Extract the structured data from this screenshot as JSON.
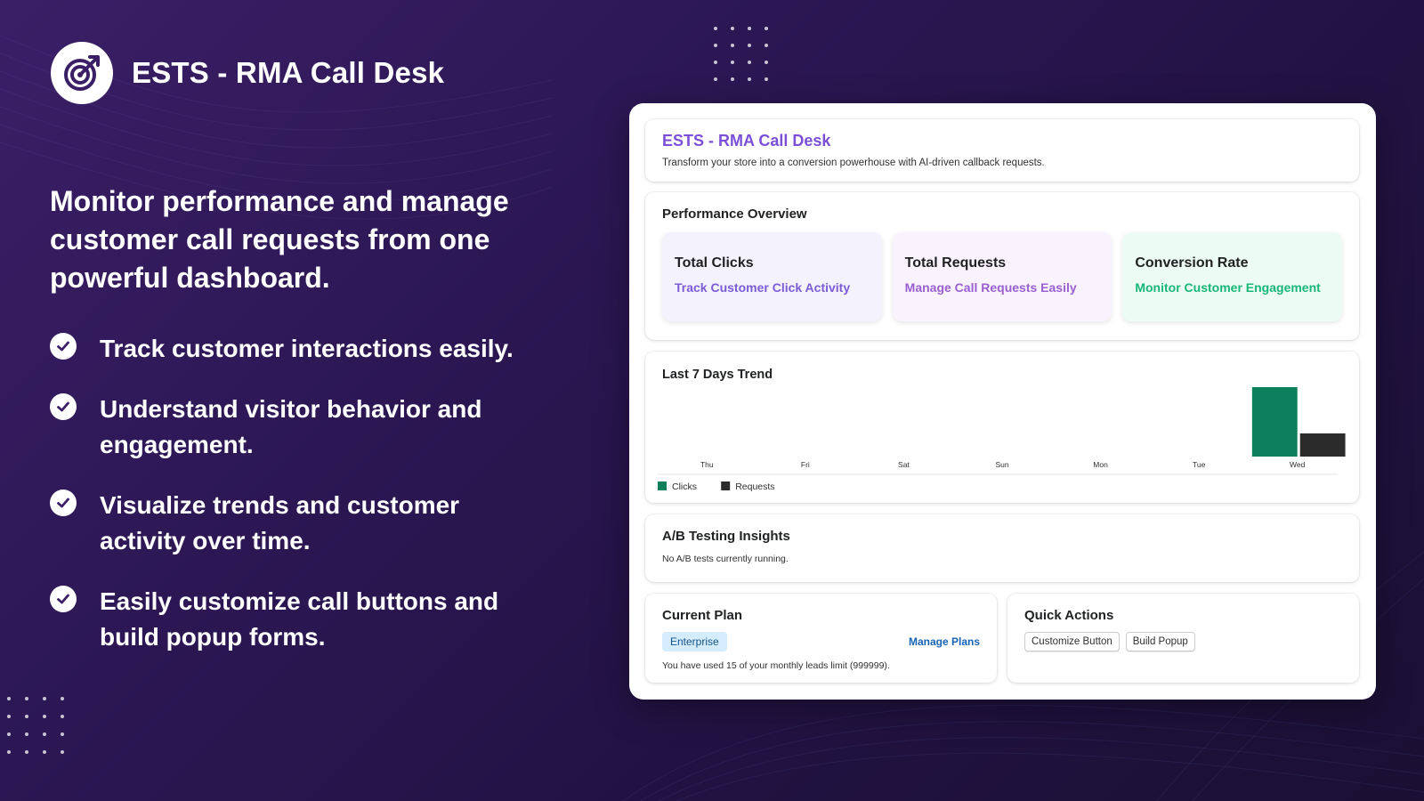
{
  "brand": {
    "title": "ESTS - RMA Call Desk",
    "logo_icon": "target-arrow-icon"
  },
  "headline": "Monitor performance and manage customer call requests from one powerful dashboard.",
  "features": [
    "Track customer interactions easily.",
    "Understand visitor behavior and engagement.",
    "Visualize trends and customer activity over time.",
    "Easily customize call buttons and build popup forms."
  ],
  "app": {
    "title": "ESTS - RMA Call Desk",
    "subtitle": "Transform your store into a conversion powerhouse with AI-driven callback requests."
  },
  "performance": {
    "title": "Performance Overview",
    "cards": [
      {
        "title": "Total Clicks",
        "subtitle": "Track Customer Click Activity",
        "accent": "#7b5bd6"
      },
      {
        "title": "Total Requests",
        "subtitle": "Manage Call Requests Easily",
        "accent": "#9a5fd1"
      },
      {
        "title": "Conversion Rate",
        "subtitle": "Monitor Customer Engagement",
        "accent": "#19b777"
      }
    ]
  },
  "trend": {
    "title": "Last 7 Days Trend"
  },
  "chart_data": {
    "type": "bar",
    "title": "Last 7 Days Trend",
    "categories": [
      "Thu",
      "Fri",
      "Sat",
      "Sun",
      "Mon",
      "Tue",
      "Wed"
    ],
    "series": [
      {
        "name": "Clicks",
        "color": "#0e7f5d",
        "values": [
          0,
          0,
          0,
          0,
          0,
          0,
          3
        ]
      },
      {
        "name": "Requests",
        "color": "#2b2b2b",
        "values": [
          0,
          0,
          0,
          0,
          0,
          0,
          1
        ]
      }
    ],
    "ylim": [
      0,
      3
    ],
    "grid": false,
    "legend": "bottom-left"
  },
  "ab_testing": {
    "title": "A/B Testing Insights",
    "message": "No A/B tests currently running."
  },
  "plan": {
    "title": "Current Plan",
    "badge": "Enterprise",
    "manage_label": "Manage Plans",
    "usage": "You have used 15 of your monthly leads limit (999999)."
  },
  "quick_actions": {
    "title": "Quick Actions",
    "buttons": [
      "Customize Button",
      "Build Popup"
    ]
  }
}
